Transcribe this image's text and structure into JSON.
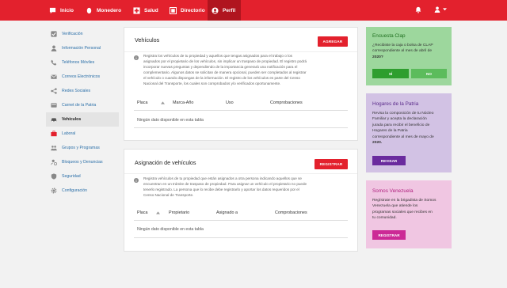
{
  "nav": {
    "items": [
      {
        "label": "Inicio",
        "icon": "chat-bubble-icon"
      },
      {
        "label": "Monedero",
        "icon": "wallet-icon"
      },
      {
        "label": "Salud",
        "icon": "health-cross-icon"
      },
      {
        "label": "Directorio",
        "icon": "directory-icon"
      },
      {
        "label": "Perfil",
        "icon": "user-circle-icon"
      }
    ],
    "active_index": 4
  },
  "sidebar": {
    "items": [
      {
        "label": "Verificación"
      },
      {
        "label": "Información Personal"
      },
      {
        "label": "Teléfonos Móviles"
      },
      {
        "label": "Correos Electrónicos"
      },
      {
        "label": "Redes Sociales"
      },
      {
        "label": "Carnet de la Patria"
      },
      {
        "label": "Vehículos"
      },
      {
        "label": "Laboral"
      },
      {
        "label": "Grupos y Programas"
      },
      {
        "label": "Bloqueos y Denuncias"
      },
      {
        "label": "Seguridad"
      },
      {
        "label": "Configuración"
      }
    ],
    "active_index": 6
  },
  "vehiculos": {
    "title": "Vehículos",
    "button": "AGREGAR",
    "info_lines": [
      "Registra los vehículos de tu propiedad y aquellos que tengas asignados para el trabajo o los",
      "asignados por el propietario de los vehículos, sin implicar un traspaso de propiedad. El registro podrá",
      "incorporar nuevas preguntas y dependiendo de la importancia generará una notificación para el",
      "complementario. Algunos datos se solicitan de manera opcional, pueden ser completados al registrar",
      "el vehículo o cuando dispongas de la información. El registro de los vehículos es parte del Censo",
      "Nacional del Transporte, los cuales son comprobados y/o verificados oportunamente."
    ],
    "columns": [
      "Placa",
      "Marca-Año",
      "Uso",
      "Comprobaciones"
    ],
    "empty": "Ningún dato disponible en esta tabla"
  },
  "asignacion": {
    "title": "Asignación de vehículos",
    "button": "REGISTRAR",
    "info_lines": [
      "Registra vehículos de tu propiedad que están asignados a otra persona indicando aquellos que se",
      "encuentran en un trámite de traspaso de propiedad. Para asignar un vehículo el propietario no puede",
      "tenerlo registrado. La persona que lo recibe debe registrarlo y aportar los datos requeridos por el",
      "Censo Nacional de Transporte."
    ],
    "columns": [
      "Placa",
      "Propietario",
      "Asignado a",
      "Comprobaciones"
    ],
    "empty": "Ningún dato disponible en esta tabla"
  },
  "panels": {
    "clap": {
      "title": "Encuesta Clap",
      "text_lines": [
        "¿Recibiste la caja o bolsa de CLAP",
        "correspondiente al mes de abril de",
        "2020?"
      ],
      "yes": "SÍ",
      "no": "NO",
      "color": "#9dd79d",
      "header_color": "#2e9e2e"
    },
    "hogares": {
      "title": "Hogares de la Patria",
      "text_lines": [
        "Revisa la composición de tu Núcleo",
        "Familiar y acepta la declaración",
        "jurada para recibir el beneficio de",
        "Hogares de la Patria",
        "correspondiente al mes de mayo de",
        "2020."
      ],
      "button": "REVISAR",
      "color": "#d2c2e4",
      "header_color": "#6a2b9e"
    },
    "somos": {
      "title": "Somos Venezuela",
      "text_lines": [
        "Regístrate en la brigadista de Somos",
        "Venezuela que atiende los",
        "programas sociales que recibes en",
        "tu comunidad."
      ],
      "button": "REGISTRAR",
      "color": "#f0c6e2",
      "header_color": "#cc2a96"
    }
  }
}
